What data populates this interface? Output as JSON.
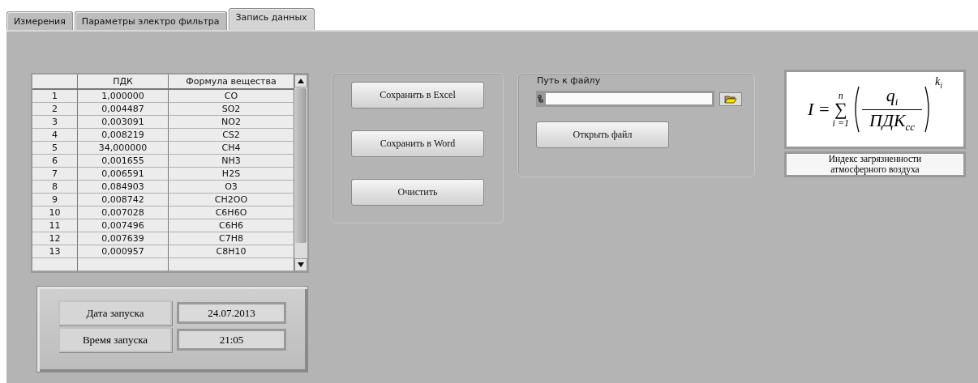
{
  "tabs": [
    {
      "label": "Измерения",
      "selected": false
    },
    {
      "label": "Параметры электро фильтра",
      "selected": false
    },
    {
      "label": "Запись данных",
      "selected": true
    }
  ],
  "table": {
    "columns": [
      "ПДК",
      "Формула вещества"
    ],
    "rows": [
      {
        "index": "1",
        "pdk": "1,000000",
        "formula": "CO"
      },
      {
        "index": "2",
        "pdk": "0,004487",
        "formula": "SO2"
      },
      {
        "index": "3",
        "pdk": "0,003091",
        "formula": "NO2"
      },
      {
        "index": "4",
        "pdk": "0,008219",
        "formula": "CS2"
      },
      {
        "index": "5",
        "pdk": "34,000000",
        "formula": "CH4"
      },
      {
        "index": "6",
        "pdk": "0,001655",
        "formula": "NH3"
      },
      {
        "index": "7",
        "pdk": "0,006591",
        "formula": "H2S"
      },
      {
        "index": "8",
        "pdk": "0,084903",
        "formula": "O3"
      },
      {
        "index": "9",
        "pdk": "0,008742",
        "formula": "CH2OO"
      },
      {
        "index": "10",
        "pdk": "0,007028",
        "formula": "C6H6O"
      },
      {
        "index": "11",
        "pdk": "0,007496",
        "formula": "C6H6"
      },
      {
        "index": "12",
        "pdk": "0,007639",
        "formula": "C7H8"
      },
      {
        "index": "13",
        "pdk": "0,000957",
        "formula": "C8H10"
      }
    ]
  },
  "launch": [
    {
      "label": "Дата запуска",
      "value": "24.07.2013"
    },
    {
      "label": "Время запуска",
      "value": "21:05"
    }
  ],
  "save_buttons": [
    "Сохранить в Excel",
    "Сохранить в Word",
    "Очистить"
  ],
  "file": {
    "label": "Путь к файлу",
    "open_button": "Открыть файл"
  },
  "formula": {
    "lhs": "I =",
    "sum": "∑",
    "upper": "n",
    "lower": "i =1",
    "numerator": "q",
    "numerator_sub": "i",
    "denominator": "ПДК",
    "denominator_sub": "cc",
    "power": "k",
    "power_sub": "i"
  },
  "formula_caption": "Индекс загрязненности атмосферного воздуха"
}
